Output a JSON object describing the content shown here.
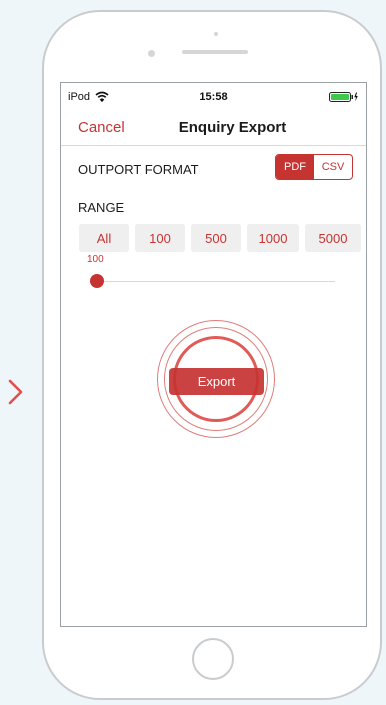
{
  "status_bar": {
    "carrier": "iPod",
    "time": "15:58"
  },
  "nav": {
    "cancel_label": "Cancel",
    "title": "Enquiry Export"
  },
  "format": {
    "label": "OUTPORT FORMAT",
    "options": [
      "PDF",
      "CSV"
    ],
    "selected": "PDF"
  },
  "range": {
    "label": "RANGE",
    "options": [
      "All",
      "100",
      "500",
      "1000",
      "5000"
    ],
    "slider_value": "100"
  },
  "export_label": "Export",
  "colors": {
    "accent": "#c63432",
    "background": "#eef6f9"
  },
  "icons": [
    "chevron-right-icon",
    "wifi-icon",
    "battery-icon"
  ]
}
